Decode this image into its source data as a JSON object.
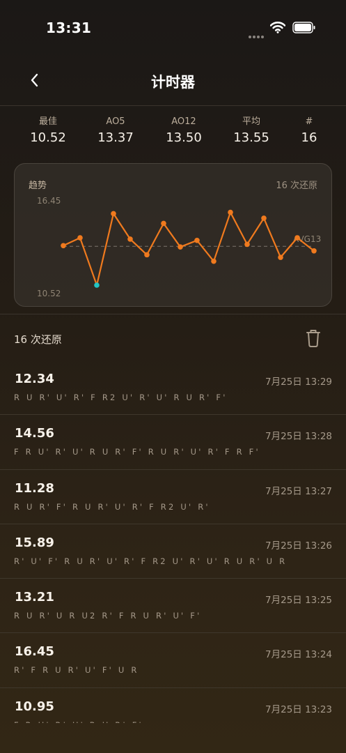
{
  "status_bar": {
    "time": "13:31"
  },
  "nav": {
    "title": "计时器"
  },
  "stats": [
    {
      "label": "最佳",
      "value": "10.52"
    },
    {
      "label": "AO5",
      "value": "13.37"
    },
    {
      "label": "AO12",
      "value": "13.50"
    },
    {
      "label": "平均",
      "value": "13.55"
    },
    {
      "label": "#",
      "value": "16"
    }
  ],
  "chart": {
    "title": "趋势",
    "count_label": "16 次还原",
    "y_max_label": "16.45",
    "y_min_label": "10.52",
    "avg_label": "AVG13",
    "line_color": "#f07a1e",
    "best_color": "#22c4c4"
  },
  "chart_data": {
    "type": "line",
    "title": "趋势",
    "ylim": [
      10.52,
      16.45
    ],
    "x": [
      1,
      2,
      3,
      4,
      5,
      6,
      7,
      8,
      9,
      10,
      11,
      12,
      13,
      14,
      15,
      16
    ],
    "values": [
      13.55,
      14.15,
      10.52,
      16.0,
      14.05,
      12.85,
      15.25,
      13.45,
      13.95,
      12.35,
      16.1,
      13.65,
      15.65,
      12.65,
      14.15,
      13.15
    ],
    "avg_line": 13.5,
    "grid": false
  },
  "list": {
    "count_label": "16 次还原"
  },
  "solves": [
    {
      "time": "12.34",
      "date": "7月25日 13:29",
      "scramble": "R U R' U' R' F R2 U' R' U' R U R' F'"
    },
    {
      "time": "14.56",
      "date": "7月25日 13:28",
      "scramble": "F R U' R' U' R U R' F' R U R' U' R' F R F'"
    },
    {
      "time": "11.28",
      "date": "7月25日 13:27",
      "scramble": "R U R' F' R U R' U' R' F R2 U' R'"
    },
    {
      "time": "15.89",
      "date": "7月25日 13:26",
      "scramble": "R' U' F' R U R' U' R' F R2 U' R' U' R U R' U R"
    },
    {
      "time": "13.21",
      "date": "7月25日 13:25",
      "scramble": "R U R' U R U2 R' F R U R' U' F'"
    },
    {
      "time": "16.45",
      "date": "7月25日 13:24",
      "scramble": "R' F R U R' U' F' U R"
    },
    {
      "time": "10.95",
      "date": "7月25日 13:23",
      "scramble": "F R U' R' U' R U R' F'"
    }
  ]
}
